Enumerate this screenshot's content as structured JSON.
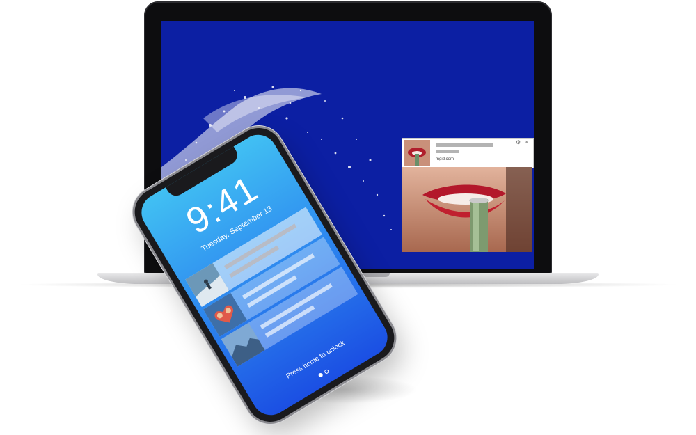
{
  "laptop": {
    "wallpaper": "blue-water-splash",
    "screen_color": "#0c1fa3",
    "notification": {
      "site": "mgid.com",
      "icons": [
        "gear-icon",
        "close-icon"
      ],
      "thumbnail": "lips-bottle-thumbnail",
      "image": "lips-bottle-ad-image"
    }
  },
  "phone": {
    "time": "9:41",
    "date": "Tuesday, September 13",
    "unlock_text": "Press home to unlock",
    "page_dots": 2,
    "notifications": [
      {
        "thumbnail": "surfer-thumbnail"
      },
      {
        "thumbnail": "couple-heart-thumbnail"
      },
      {
        "thumbnail": "landscape-thumbnail"
      }
    ],
    "screen_gradient": [
      "#41c0f3",
      "#1b4fe3"
    ]
  }
}
